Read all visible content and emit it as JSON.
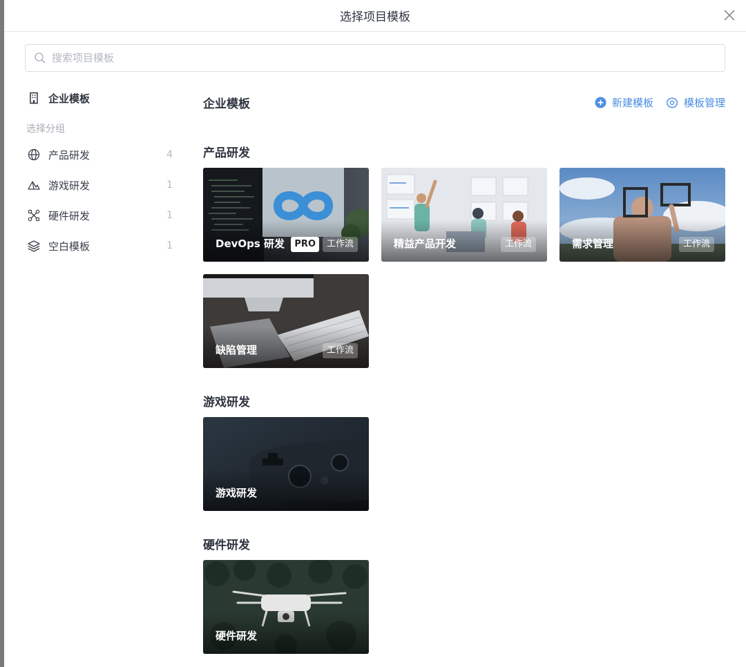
{
  "dialog": {
    "title": "选择项目模板"
  },
  "search": {
    "placeholder": "搜索项目模板"
  },
  "sidebar": {
    "top_item": {
      "label": "企业模板",
      "icon": "building-icon"
    },
    "group_label": "选择分组",
    "items": [
      {
        "label": "产品研发",
        "count": "4",
        "icon": "globe-icon"
      },
      {
        "label": "游戏研发",
        "count": "1",
        "icon": "mountain-icon"
      },
      {
        "label": "硬件研发",
        "count": "1",
        "icon": "tools-icon"
      },
      {
        "label": "空白模板",
        "count": "1",
        "icon": "layers-icon"
      }
    ]
  },
  "main": {
    "title": "企业模板",
    "actions": [
      {
        "label": "新建模板",
        "icon": "plus-circle-icon"
      },
      {
        "label": "模板管理",
        "icon": "gear-icon"
      }
    ],
    "sections": [
      {
        "title": "产品研发",
        "cards": [
          {
            "label": "DevOps 研发",
            "pro": "PRO",
            "flow": "工作流"
          },
          {
            "label": "精益产品开发",
            "flow": "工作流"
          },
          {
            "label": "需求管理",
            "flow": "工作流"
          },
          {
            "label": "缺陷管理",
            "flow": "工作流"
          }
        ]
      },
      {
        "title": "游戏研发",
        "cards": [
          {
            "label": "游戏研发"
          }
        ]
      },
      {
        "title": "硬件研发",
        "cards": [
          {
            "label": "硬件研发"
          }
        ]
      }
    ]
  },
  "colors": {
    "accent": "#4a8de0",
    "text": "#2f3440",
    "muted": "#a8acb3"
  }
}
